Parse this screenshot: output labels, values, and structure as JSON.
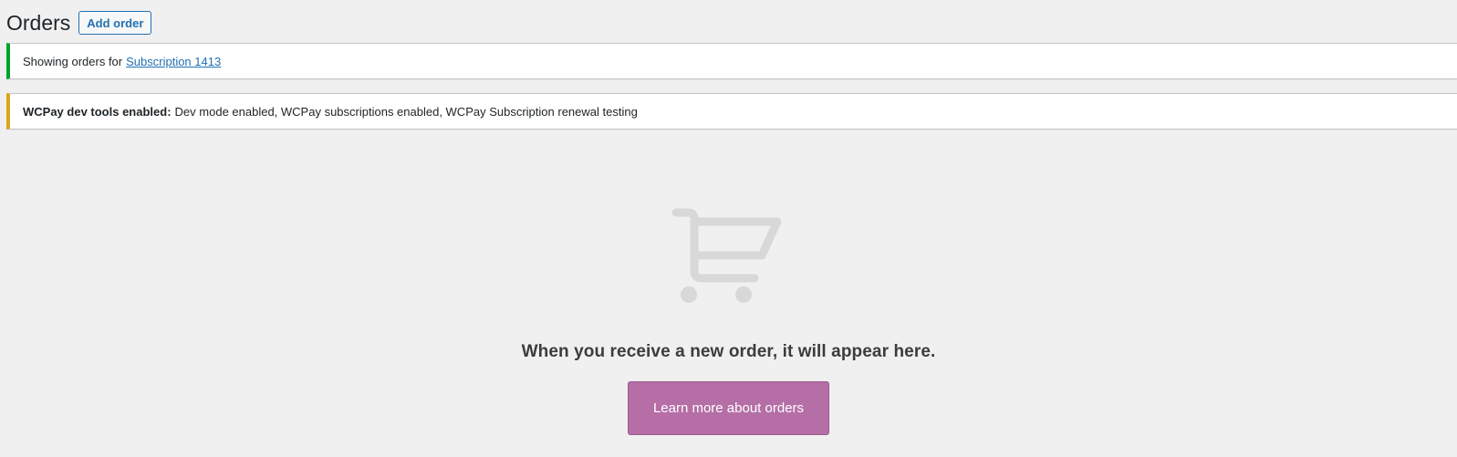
{
  "header": {
    "title": "Orders",
    "add_label": "Add order"
  },
  "notices": {
    "filter": {
      "prefix": "Showing orders for",
      "link": "Subscription 1413"
    },
    "devtools": {
      "label": "WCPay dev tools enabled:",
      "text": "Dev mode enabled, WCPay subscriptions enabled, WCPay Subscription renewal testing"
    }
  },
  "empty_state": {
    "icon": "cart-icon",
    "message": "When you receive a new order, it will appear here.",
    "button_label": "Learn more about orders"
  },
  "colors": {
    "success": "#00a32a",
    "warning": "#dba617",
    "primary_button": "#b56ea6",
    "link": "#2271b1"
  }
}
